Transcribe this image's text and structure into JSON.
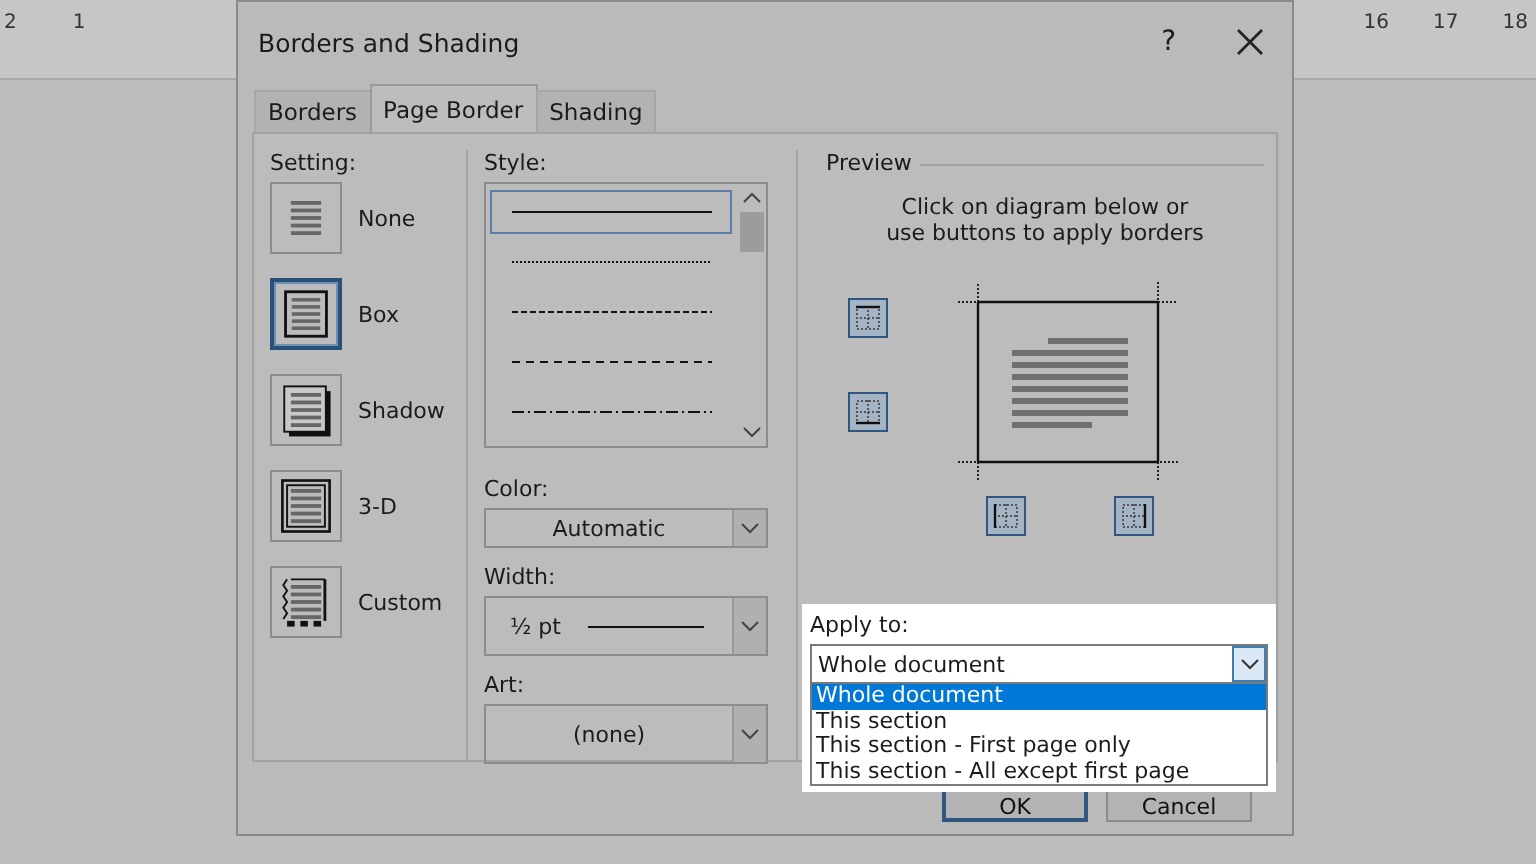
{
  "ruler": {
    "left_numbers": [
      "2",
      "1"
    ],
    "right_numbers": [
      "16",
      "17",
      "18"
    ]
  },
  "window": {
    "title": "Borders and Shading",
    "help": "?"
  },
  "tabs": [
    {
      "label": "Borders",
      "selected": false
    },
    {
      "label": "Page Border",
      "selected": true
    },
    {
      "label": "Shading",
      "selected": false
    }
  ],
  "setting": {
    "label": "Setting:",
    "items": [
      {
        "label": "None",
        "kind": "none",
        "selected": false
      },
      {
        "label": "Box",
        "kind": "box",
        "selected": true
      },
      {
        "label": "Shadow",
        "kind": "shadow",
        "selected": false
      },
      {
        "label": "3-D",
        "kind": "framed",
        "selected": false
      },
      {
        "label": "Custom",
        "kind": "custom",
        "selected": false
      }
    ]
  },
  "style": {
    "label": "Style:",
    "items": [
      {
        "kind": "solid",
        "selected": true
      },
      {
        "kind": "dotted",
        "selected": false
      },
      {
        "kind": "fine-dash",
        "selected": false
      },
      {
        "kind": "dash",
        "selected": false
      },
      {
        "kind": "dash-dot",
        "selected": false
      }
    ]
  },
  "color": {
    "label": "Color:",
    "value": "Automatic"
  },
  "width": {
    "label": "Width:",
    "value": "½ pt"
  },
  "art": {
    "label": "Art:",
    "value": "(none)"
  },
  "preview": {
    "label": "Preview",
    "hint": "Click on diagram below or\nuse buttons to apply borders",
    "border_buttons": [
      {
        "kind": "top",
        "on": true
      },
      {
        "kind": "bottom",
        "on": true
      },
      {
        "kind": "left",
        "on": true
      },
      {
        "kind": "right",
        "on": true
      }
    ]
  },
  "apply_to": {
    "label": "Apply to:",
    "value": "Whole document",
    "options": [
      {
        "label": "Whole document",
        "selected": true
      },
      {
        "label": "This section",
        "selected": false
      },
      {
        "label": "This section - First page only",
        "selected": false
      },
      {
        "label": "This section - All except first page",
        "selected": false
      }
    ]
  },
  "buttons": [
    {
      "label": "OK"
    },
    {
      "label": "Cancel"
    }
  ]
}
